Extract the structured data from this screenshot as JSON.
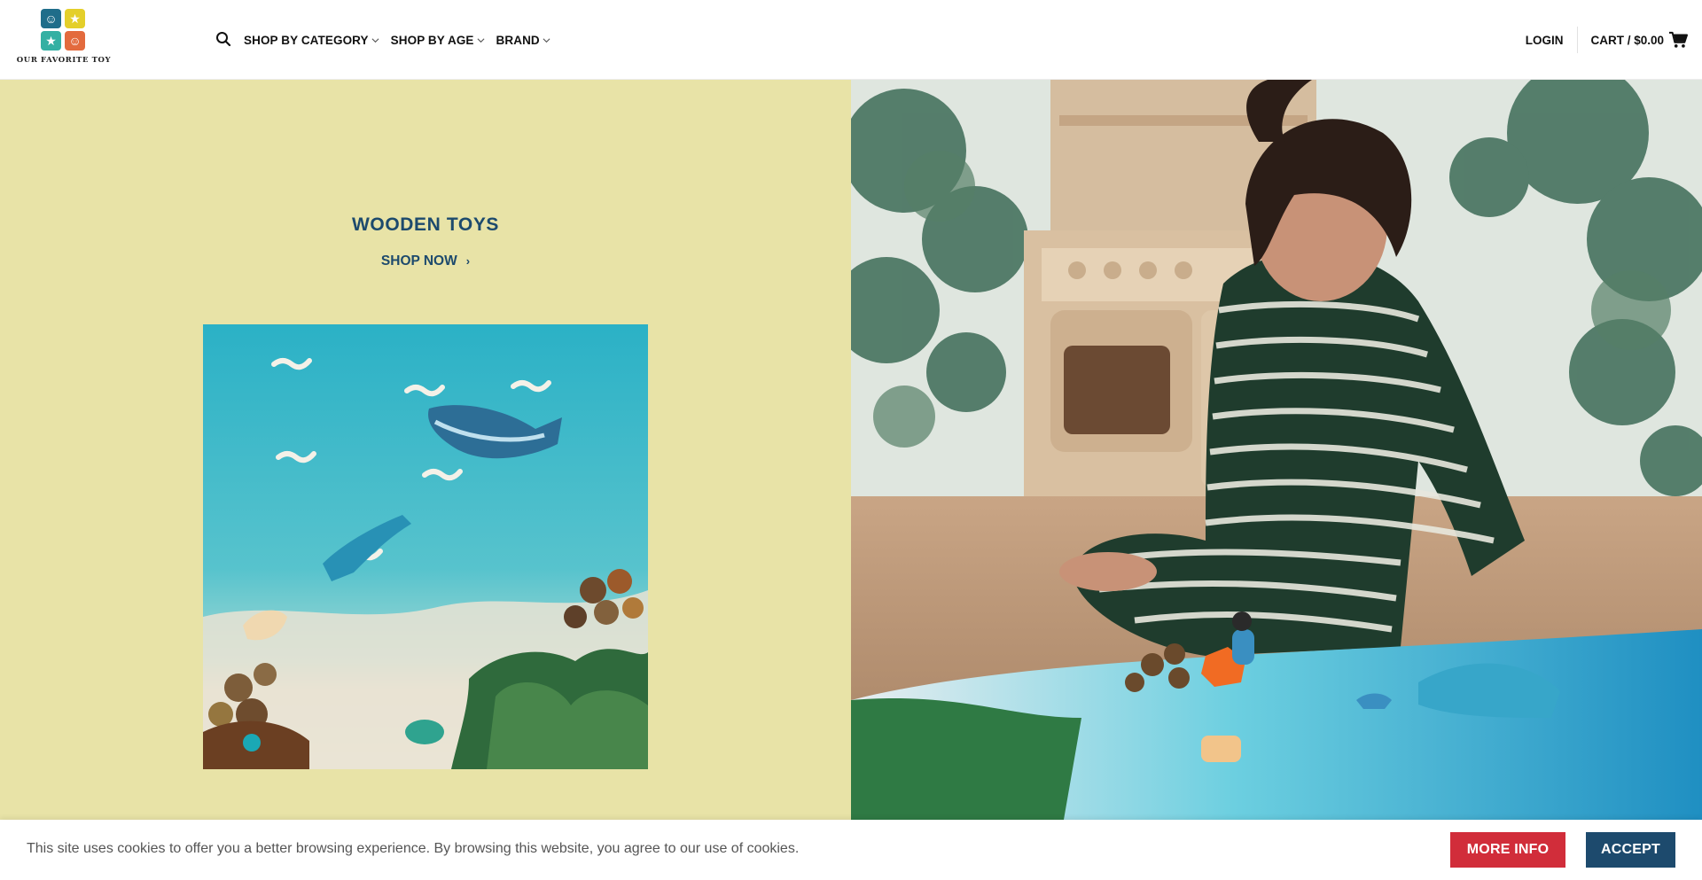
{
  "brand": {
    "name": "OUR FAVORITE TOY",
    "logo_tile_colors": [
      "#1f6d8a",
      "#e4cf2a",
      "#34b0a3",
      "#e36a3d"
    ]
  },
  "nav": {
    "search_icon": "search-icon",
    "items": [
      {
        "label": "SHOP BY CATEGORY",
        "has_dropdown": true
      },
      {
        "label": "SHOP BY AGE",
        "has_dropdown": true
      },
      {
        "label": "BRAND",
        "has_dropdown": true
      }
    ]
  },
  "account": {
    "login_label": "LOGIN",
    "cart_label": "CART / $0.00",
    "cart_icon": "shopping-cart-icon"
  },
  "hero": {
    "title": "WOODEN TOYS",
    "cta_label": "SHOP NOW",
    "cta_arrow": "›",
    "panel_color": "#e8e3a7",
    "text_color": "#1d4a6d"
  },
  "cookie_notice": {
    "message": "This site uses cookies to offer you a better browsing experience. By browsing this website, you agree to our use of cookies.",
    "more_info_label": "MORE INFO",
    "accept_label": "ACCEPT",
    "more_info_color": "#d12d3a",
    "accept_color": "#1d4a6d"
  }
}
